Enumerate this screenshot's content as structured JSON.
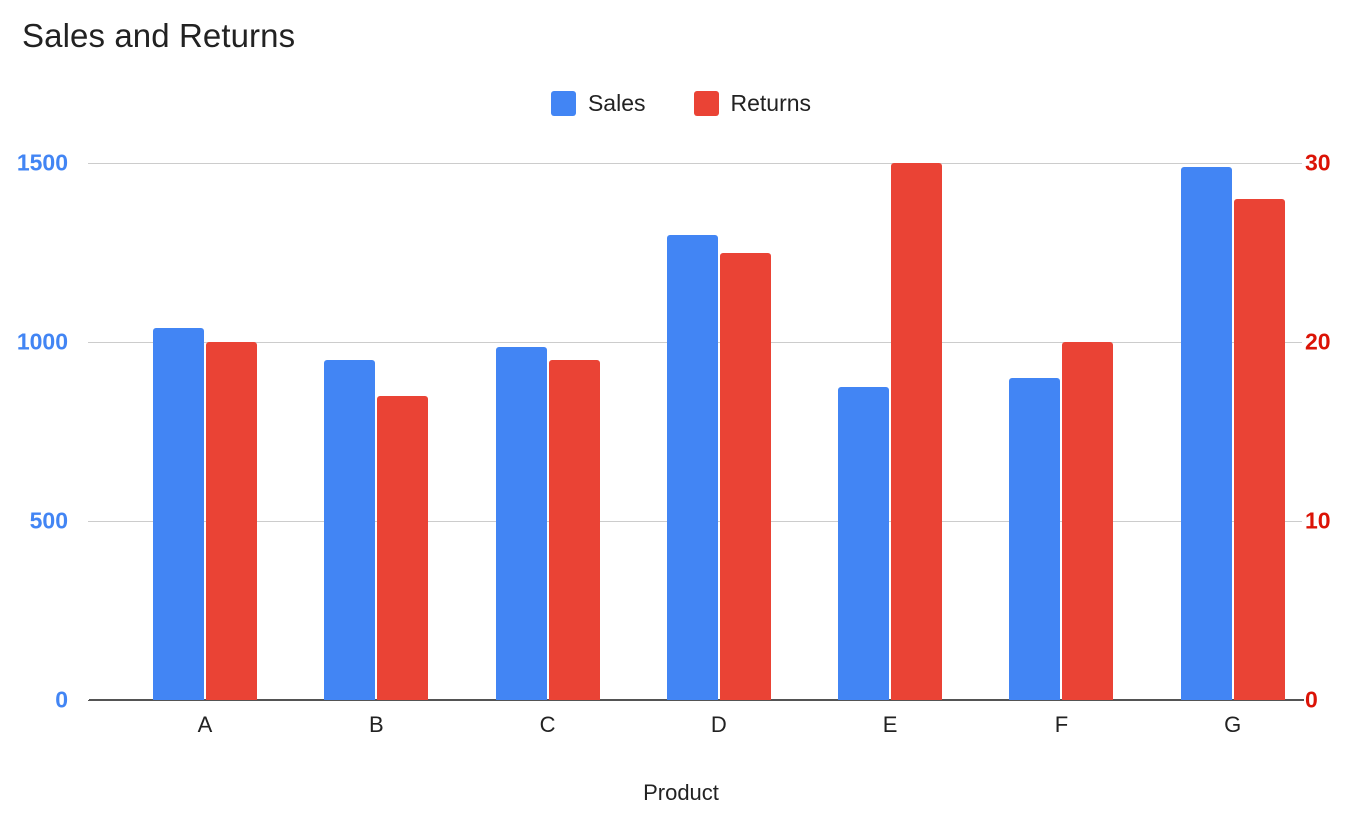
{
  "chart_data": {
    "type": "bar",
    "title": "Sales and Returns",
    "xlabel": "Product",
    "ylabel": "",
    "categories": [
      "A",
      "B",
      "C",
      "D",
      "E",
      "F",
      "G"
    ],
    "series": [
      {
        "name": "Sales",
        "color": "#4285F4",
        "axis": "left",
        "values": [
          1040,
          950,
          985,
          1300,
          875,
          900,
          1490
        ]
      },
      {
        "name": "Returns",
        "color": "#EA4335",
        "axis": "right",
        "values": [
          20,
          17,
          19,
          25,
          30,
          20,
          28
        ]
      }
    ],
    "left_axis": {
      "ticks": [
        "0",
        "500",
        "1000",
        "1500"
      ],
      "tick_values": [
        0,
        500,
        1000,
        1500
      ],
      "ylim": [
        0,
        1500
      ],
      "color": "#4285F4"
    },
    "right_axis": {
      "ticks": [
        "0",
        "10",
        "20",
        "30"
      ],
      "tick_values": [
        0,
        10,
        20,
        30
      ],
      "ylim": [
        0,
        30
      ],
      "color": "#DB1306"
    },
    "grid": true,
    "legend_position": "top-center",
    "background": "#ffffff"
  },
  "legend": {
    "items": [
      {
        "label": "Sales",
        "color": "#4285F4"
      },
      {
        "label": "Returns",
        "color": "#EA4335"
      }
    ]
  }
}
